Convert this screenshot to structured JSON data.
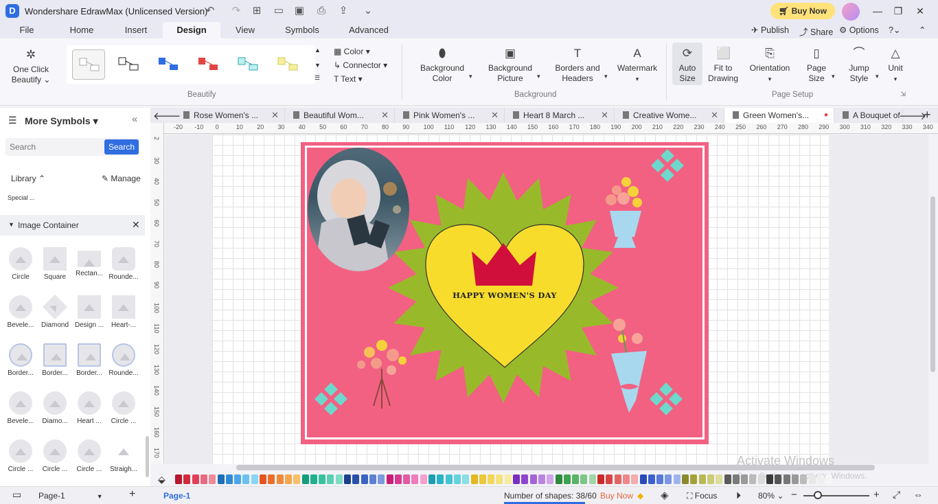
{
  "titlebar": {
    "app_title": "Wondershare EdrawMax (Unlicensed Version)",
    "buy_now": "Buy Now"
  },
  "menu": {
    "items": [
      "File",
      "Home",
      "Insert",
      "Design",
      "View",
      "Symbols",
      "Advanced"
    ],
    "active": "Design",
    "publish": "Publish",
    "share": "Share",
    "options": "Options"
  },
  "ribbon": {
    "one_click_beautify": "One Click Beautify",
    "color": "Color",
    "connector": "Connector",
    "text": "Text",
    "beautify_group": "Beautify",
    "background_color": "Background Color",
    "background_picture": "Background Picture",
    "borders_headers": "Borders and Headers",
    "watermark": "Watermark",
    "background_group": "Background",
    "auto_size": "Auto Size",
    "fit_to_drawing": "Fit to Drawing",
    "orientation": "Orientation",
    "page_size": "Page Size",
    "jump_style": "Jump Style",
    "unit": "Unit",
    "page_setup_group": "Page Setup"
  },
  "sidebar": {
    "title": "More Symbols",
    "search_placeholder": "Search",
    "search_btn": "Search",
    "library": "Library",
    "manage": "Manage",
    "special": "Special ...",
    "image_container": "Image Container",
    "shapes": [
      [
        "Circle",
        "Square",
        "Rectan...",
        "Rounde..."
      ],
      [
        "Bevele...",
        "Diamond",
        "Design ...",
        "Heart-..."
      ],
      [
        "Border...",
        "Border...",
        "Border...",
        "Rounde..."
      ],
      [
        "Bevele...",
        "Diamo...",
        "Heart ...",
        "Circle ..."
      ],
      [
        "Circle ...",
        "Circle ...",
        "Circle ...",
        "Straigh..."
      ]
    ]
  },
  "tabs": [
    "Rose Women's ...",
    "Beautiful Wom...",
    "Pink Women's ...",
    "Heart 8 March ...",
    "Creative Wome...",
    "Green Women's...",
    "A Bouquet of"
  ],
  "ruler_h": [
    "-20",
    "-10",
    "0",
    "10",
    "20",
    "30",
    "40",
    "50",
    "60",
    "70",
    "80",
    "90",
    "100",
    "110",
    "120",
    "130",
    "140",
    "150",
    "160",
    "170",
    "180",
    "190",
    "200",
    "210",
    "220",
    "230",
    "240",
    "250",
    "260",
    "270",
    "280",
    "290",
    "300",
    "310",
    "320",
    "330",
    "340"
  ],
  "ruler_v": [
    "2",
    "30",
    "40",
    "50",
    "60",
    "70",
    "80",
    "90",
    "100",
    "110",
    "120",
    "130",
    "140",
    "150",
    "160",
    "170"
  ],
  "card": {
    "headline": "HAPPY WOMEN'S DAY"
  },
  "watermark": {
    "line1": "Activate Windows",
    "line2": "Go to Settings to activate Windows."
  },
  "colors": {
    "card_pink": "#f26182",
    "star_green": "#98ba2a",
    "heart_yellow": "#f8dc2c",
    "crown_red": "#d0103b",
    "diamond_teal": "#6ed8cc",
    "accent_blue": "#2f6de1"
  },
  "palette": [
    "#b8162d",
    "#d42a3c",
    "#e2405a",
    "#e76a7e",
    "#f08a9a",
    "#1e6fb8",
    "#2e8bd6",
    "#4aa6e8",
    "#6ac0ef",
    "#8ad4f4",
    "#e2551e",
    "#ec6d2a",
    "#f08a3a",
    "#f5a64c",
    "#f8c06a",
    "#119e7a",
    "#20b08c",
    "#38c29e",
    "#5ad0b2",
    "#7cdcc4",
    "#1a3f8f",
    "#2850a8",
    "#3a64c0",
    "#5c80d2",
    "#7c9adc",
    "#c81e78",
    "#d83a90",
    "#e45aa4",
    "#ee7cba",
    "#f4a0ce",
    "#1b9fb0",
    "#28b4c4",
    "#44c4d2",
    "#66d2de",
    "#8adee8",
    "#e2b81e",
    "#ecc83a",
    "#f2d65a",
    "#f6e27c",
    "#f9ec9e",
    "#7a2ebe",
    "#8e46cc",
    "#a464d8",
    "#ba84e2",
    "#d0a6ec",
    "#2e8a3e",
    "#3ea24e",
    "#58b466",
    "#7cc686",
    "#a0d6a8",
    "#c82a2a",
    "#d84444",
    "#e46464",
    "#ee8888",
    "#f4acac",
    "#2a4ab8",
    "#3c60cc",
    "#5a7ad8",
    "#7c96e2",
    "#a0b4ec",
    "#8a8a2a",
    "#a2a23a",
    "#b8b856",
    "#cccc78",
    "#dede9c",
    "#5a5a5a",
    "#7a7a7a",
    "#9a9a9a",
    "#bababa",
    "#dadada",
    "#3a3a3a",
    "#555555",
    "#777777",
    "#999999",
    "#bbbbbb",
    "#e8e8e8",
    "#f0f0f0",
    "#f6f6f6"
  ],
  "status": {
    "page_tab": "Page-1",
    "page_current": "Page-1",
    "shapes_count": "Number of shapes: 38/60",
    "buy_now": "Buy Now",
    "focus": "Focus",
    "zoom": "80%"
  }
}
